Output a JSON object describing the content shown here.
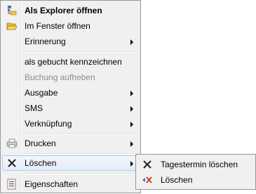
{
  "context_menu": {
    "items": [
      {
        "label": "Als Explorer öffnen",
        "icon": "explorer-icon",
        "bold": true
      },
      {
        "label": "Im Fenster öffnen",
        "icon": "open-folder-icon"
      },
      {
        "label": "Erinnerung",
        "submenu": true
      },
      {
        "label": "als gebucht kennzeichnen"
      },
      {
        "label": "Buchung aufheben",
        "disabled": true
      },
      {
        "label": "Ausgabe",
        "submenu": true
      },
      {
        "label": "SMS",
        "submenu": true
      },
      {
        "label": "Verknüpfung",
        "submenu": true
      },
      {
        "label": "Drucken",
        "icon": "printer-icon",
        "submenu": true
      },
      {
        "label": "Löschen",
        "icon": "delete-x-icon",
        "submenu": true,
        "highlighted": true
      },
      {
        "label": "Eigenschaften",
        "icon": "properties-icon"
      }
    ]
  },
  "submenu": {
    "items": [
      {
        "label": "Tagestermin löschen",
        "icon": "delete-x-icon"
      },
      {
        "label": "Löschen",
        "icon": "delete-red-x-icon"
      }
    ]
  },
  "colors": {
    "menu_bg": "#f0f0f0",
    "border": "#979797",
    "highlight_border": "#b5cbe6",
    "disabled_text": "#8d8d8d",
    "delete_red": "#d63a2a",
    "delete_blue": "#2f6fd0"
  }
}
